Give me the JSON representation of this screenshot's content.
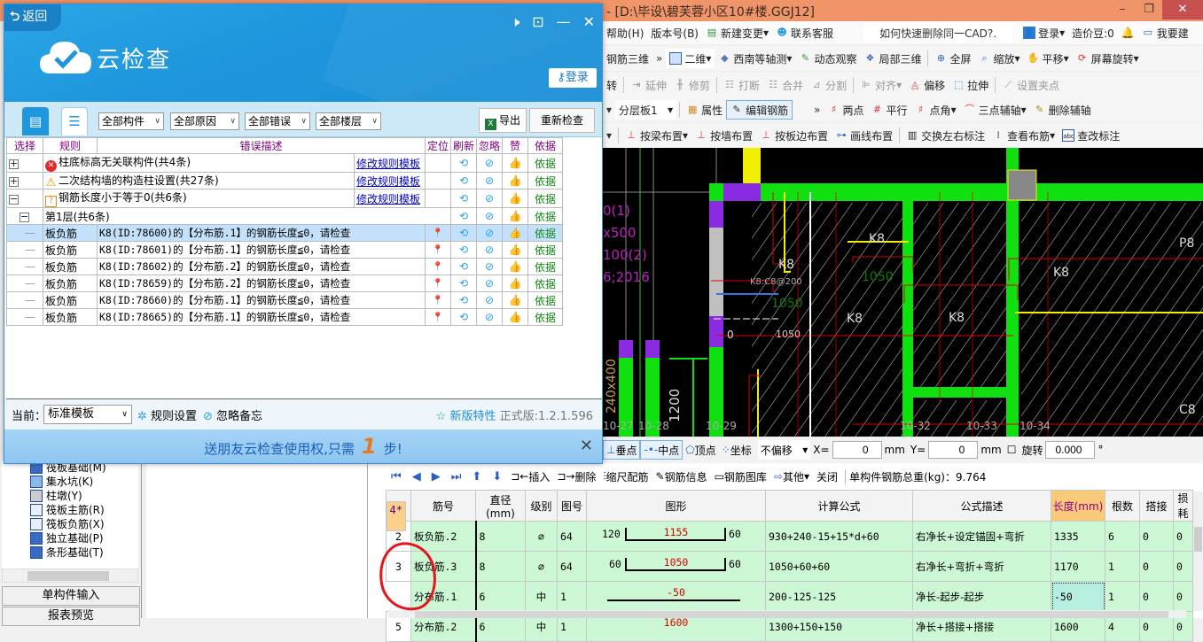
{
  "app": {
    "title": "[D:\\毕设\\碧芙蓉小区10#楼.GGJ12]",
    "title_prefix": "- ",
    "win_min": "–",
    "win_max": "❐",
    "win_close": "✕"
  },
  "menubar": {
    "items": [
      "帮助(H)",
      "版本号(B)",
      "新建变更",
      "联系客服"
    ],
    "tip": "如何快速删除同一CAD?.",
    "login": "登录",
    "beans": "造价豆:0",
    "suggest": "我要建"
  },
  "toolbar1": [
    "钢筋三维",
    "二维",
    "西南等轴测",
    "动态观察",
    "局部三维",
    "全屏",
    "缩放",
    "平移",
    "屏幕旋转"
  ],
  "toolbar2": [
    "转",
    "延伸",
    "修剪",
    "打断",
    "合并",
    "分割",
    "对齐",
    "偏移",
    "拉伸",
    "设置夹点"
  ],
  "toolbar3": {
    "layer": "分层板1",
    "items": [
      "属性",
      "编辑钢筋",
      "两点",
      "平行",
      "点角",
      "三点辅轴",
      "删除辅轴"
    ]
  },
  "toolbar4": [
    "按梁布置",
    "按墙布置",
    "按板边布置",
    "画线布置",
    "交换左右标注",
    "查看布筋",
    "查改标注"
  ],
  "cad": {
    "labels_left": [
      "0(1)",
      "x500",
      "100(2)",
      "6;2016"
    ],
    "marks": [
      "K8",
      "1050",
      "K8:C8@200",
      "1050",
      "1200",
      "240x400",
      "10-27",
      "10-28",
      "10-29",
      "10-32",
      "10-33",
      "10-34",
      "C8",
      "P8",
      "0"
    ]
  },
  "snapbar": {
    "items": [
      "垂点",
      "中点",
      "顶点",
      "坐标"
    ],
    "offset": "不偏移",
    "x_label": "X=",
    "x_value": "0",
    "unit": "mm",
    "y_label": "Y=",
    "y_value": "0",
    "rotate_label": "旋转",
    "rotate_value": "0.000",
    "deg": "°"
  },
  "rebar_tools": {
    "items": [
      "插入",
      "删除",
      "缩尺配筋",
      "钢筋信息",
      "钢筋图库",
      "其他",
      "关闭"
    ],
    "total_weight": "单构件钢筋总重(kg)：9.764"
  },
  "rebar_table": {
    "headers": [
      "",
      "筋号",
      "直径(mm)",
      "级别",
      "图号",
      "图形",
      "计算公式",
      "公式描述",
      "长度(mm)",
      "根数",
      "搭接",
      "损耗"
    ],
    "rows": [
      {
        "n": "2",
        "name": "板负筋.2",
        "dia": "8",
        "grade": "⌀",
        "fig": "64",
        "left": "120",
        "mid": "1155",
        "right": "60",
        "formula": "930+240-15+15*d+60",
        "desc": "右净长+设定锚固+弯折",
        "len": "1335",
        "count": "6",
        "lap": "0",
        "loss": "0"
      },
      {
        "n": "3",
        "name": "板负筋.3",
        "dia": "8",
        "grade": "⌀",
        "fig": "64",
        "left": "60",
        "mid": "1050",
        "right": "60",
        "formula": "1050+60+60",
        "desc": "右净长+弯折+弯折",
        "len": "1170",
        "count": "1",
        "lap": "0",
        "loss": "0"
      },
      {
        "n": "4*",
        "name": "分布筋.1",
        "dia": "6",
        "grade": "中",
        "fig": "1",
        "left": "",
        "mid": "-50",
        "right": "",
        "formula": "200-125-125",
        "desc": "净长-起步-起步",
        "len": "-50",
        "count": "1",
        "lap": "0",
        "loss": "0"
      },
      {
        "n": "5",
        "name": "分布筋.2",
        "dia": "6",
        "grade": "中",
        "fig": "1",
        "left": "",
        "mid": "1600",
        "right": "",
        "formula": "1300+150+150",
        "desc": "净长+搭接+搭接",
        "len": "1600",
        "count": "4",
        "lap": "0",
        "loss": "0"
      }
    ]
  },
  "tree": {
    "items": [
      "筏板基础(M)",
      "集水坑(K)",
      "柱墩(Y)",
      "筏板主筋(R)",
      "筏板负筋(X)",
      "独立基础(P)",
      "条形基础(T)"
    ],
    "btn1": "单构件输入",
    "btn2": "报表预览"
  },
  "dialog": {
    "back": "返回",
    "brand": "云检查",
    "login": "登录",
    "filters": [
      "全部构件",
      "全部原因",
      "全部错误",
      "全部楼层"
    ],
    "export": "导出",
    "recheck": "重新检查",
    "headers": [
      "选择",
      "规则",
      "错误描述",
      "",
      "定位",
      "刷新",
      "忽略",
      "赞",
      "依据"
    ],
    "groups": [
      {
        "type": "error",
        "label": "柱底标高无关联构件(共4条)",
        "link": "修改规则模板",
        "basis": "依据",
        "expander": "+"
      },
      {
        "type": "warning",
        "label": "二次结构墙的构造柱设置(共27条)",
        "link": "修改规则模板",
        "basis": "依据",
        "expander": "+"
      },
      {
        "type": "question",
        "label": "钢筋长度小于等于0(共6条)",
        "link": "修改规则模板",
        "basis": "依据",
        "expander": "−"
      }
    ],
    "floor": {
      "label": "第1层(共6条)",
      "basis": "依据",
      "expander": "−"
    },
    "rows": [
      {
        "rule": "板负筋",
        "desc": "K8(ID:78600)的【分布筋.1】的钢筋长度≦0，请检查",
        "basis": "依据"
      },
      {
        "rule": "板负筋",
        "desc": "K8(ID:78601)的【分布筋.1】的钢筋长度≦0，请检查",
        "basis": "依据"
      },
      {
        "rule": "板负筋",
        "desc": "K8(ID:78602)的【分布筋.2】的钢筋长度≦0，请检查",
        "basis": "依据"
      },
      {
        "rule": "板负筋",
        "desc": "K8(ID:78659)的【分布筋.2】的钢筋长度≦0，请检查",
        "basis": "依据"
      },
      {
        "rule": "板负筋",
        "desc": "K8(ID:78660)的【分布筋.1】的钢筋长度≦0，请检查",
        "basis": "依据"
      },
      {
        "rule": "板负筋",
        "desc": "K8(ID:78665)的【分布筋.1】的钢筋长度≦0，请检查",
        "basis": "依据"
      }
    ],
    "footer": {
      "current_label": "当前：",
      "template": "标准模板",
      "rule_settings": "规则设置",
      "ignore_memo": "忽略备忘",
      "new_features": "新版特性",
      "version": "正式版:1.2.1.596"
    },
    "banner": {
      "pre": "送朋友云检查使用权,只需",
      "num": "1",
      "post": "步!"
    }
  }
}
